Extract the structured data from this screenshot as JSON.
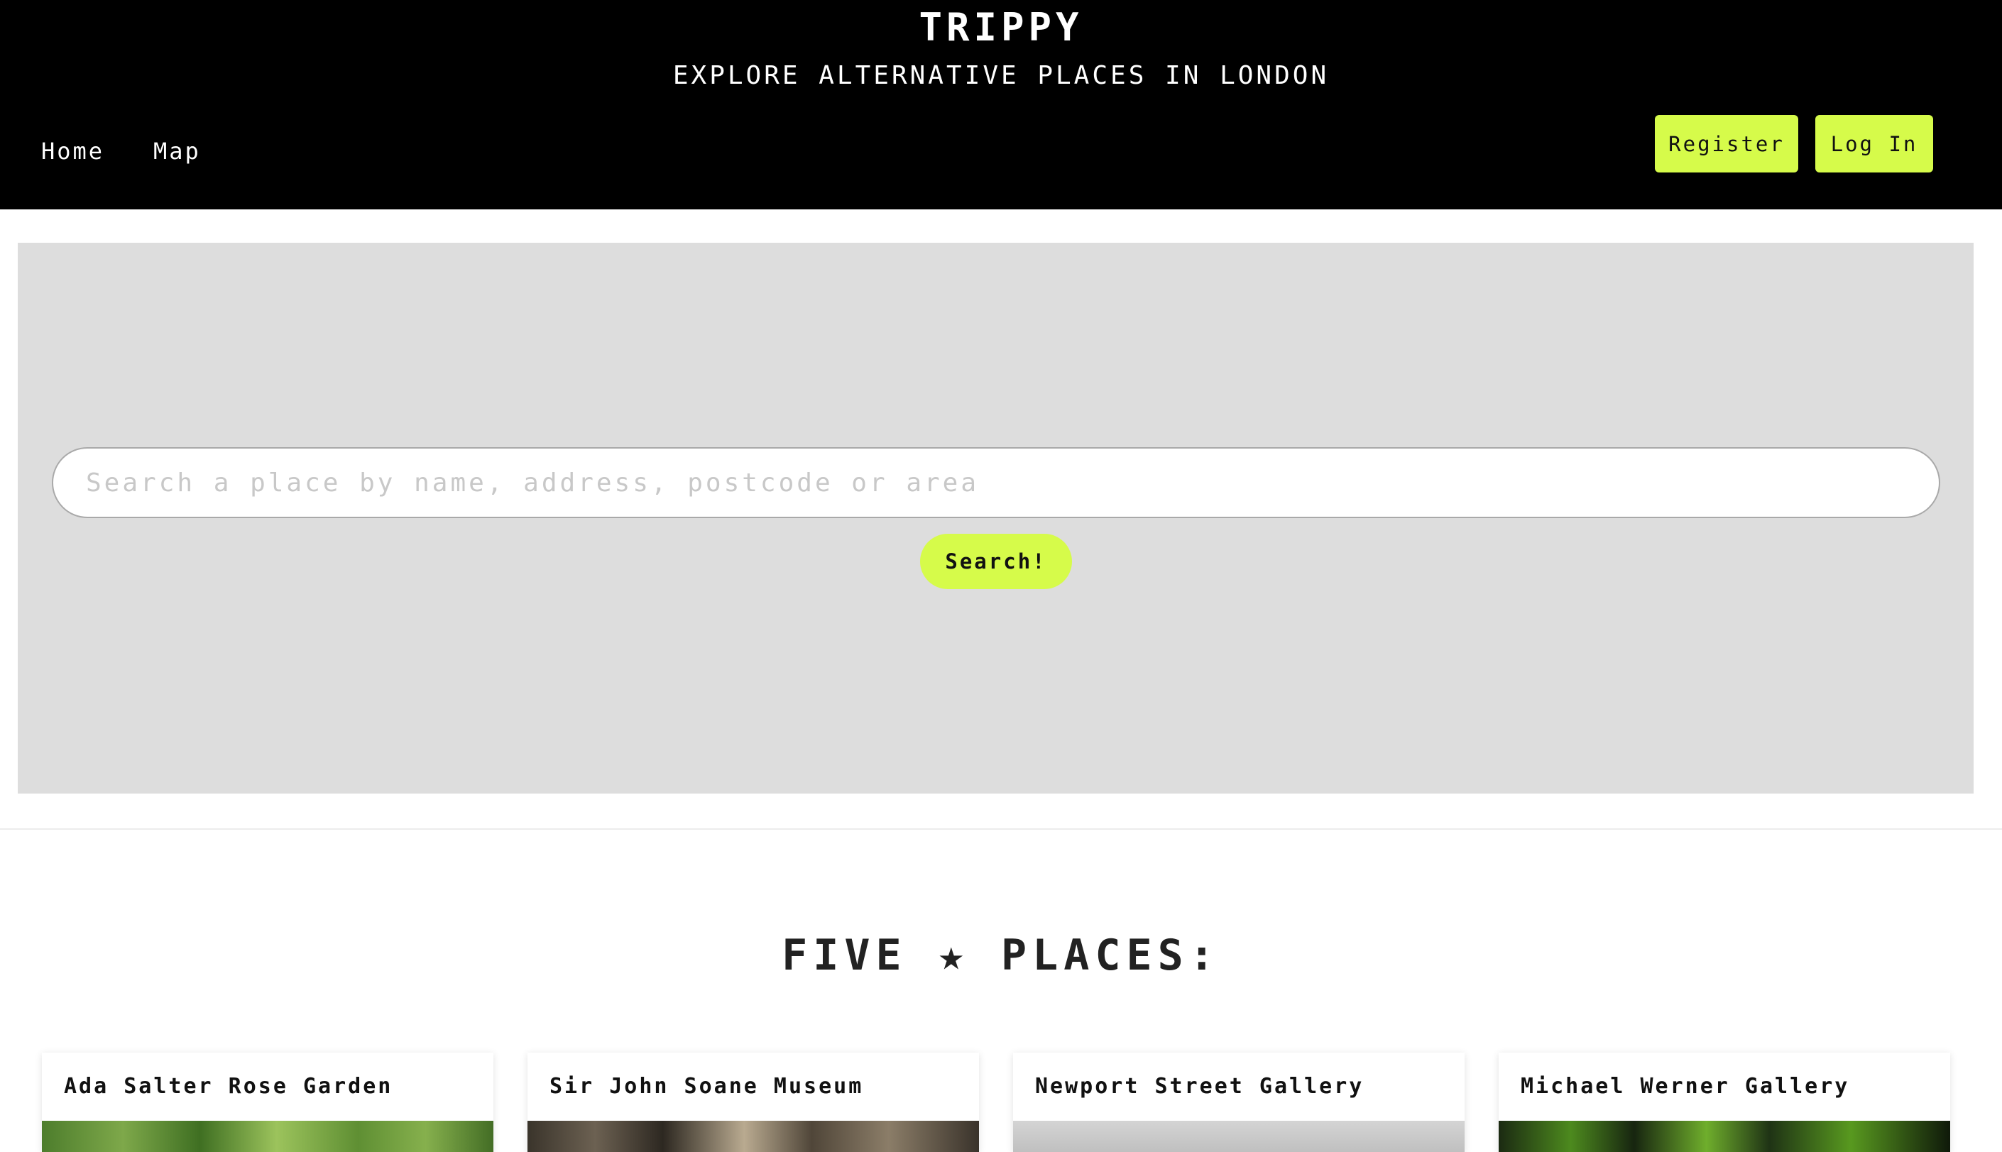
{
  "header": {
    "title": "TRIPPY",
    "subtitle": "EXPLORE ALTERNATIVE PLACES IN LONDON",
    "nav": [
      {
        "label": "Home"
      },
      {
        "label": "Map"
      }
    ],
    "register_label": "Register",
    "login_label": "Log In"
  },
  "search": {
    "placeholder": "Search a place by name, address, postcode or area",
    "value": "",
    "button_label": "Search!"
  },
  "section": {
    "heading": "FIVE ★ PLACES:"
  },
  "places": [
    {
      "name": "Ada Salter Rose Garden"
    },
    {
      "name": "Sir John Soane Museum"
    },
    {
      "name": "Newport Street Gallery"
    },
    {
      "name": "Michael Werner Gallery"
    }
  ],
  "colors": {
    "accent": "#d6fb4a",
    "header_bg": "#000000",
    "hero_bg": "#dddddd"
  }
}
